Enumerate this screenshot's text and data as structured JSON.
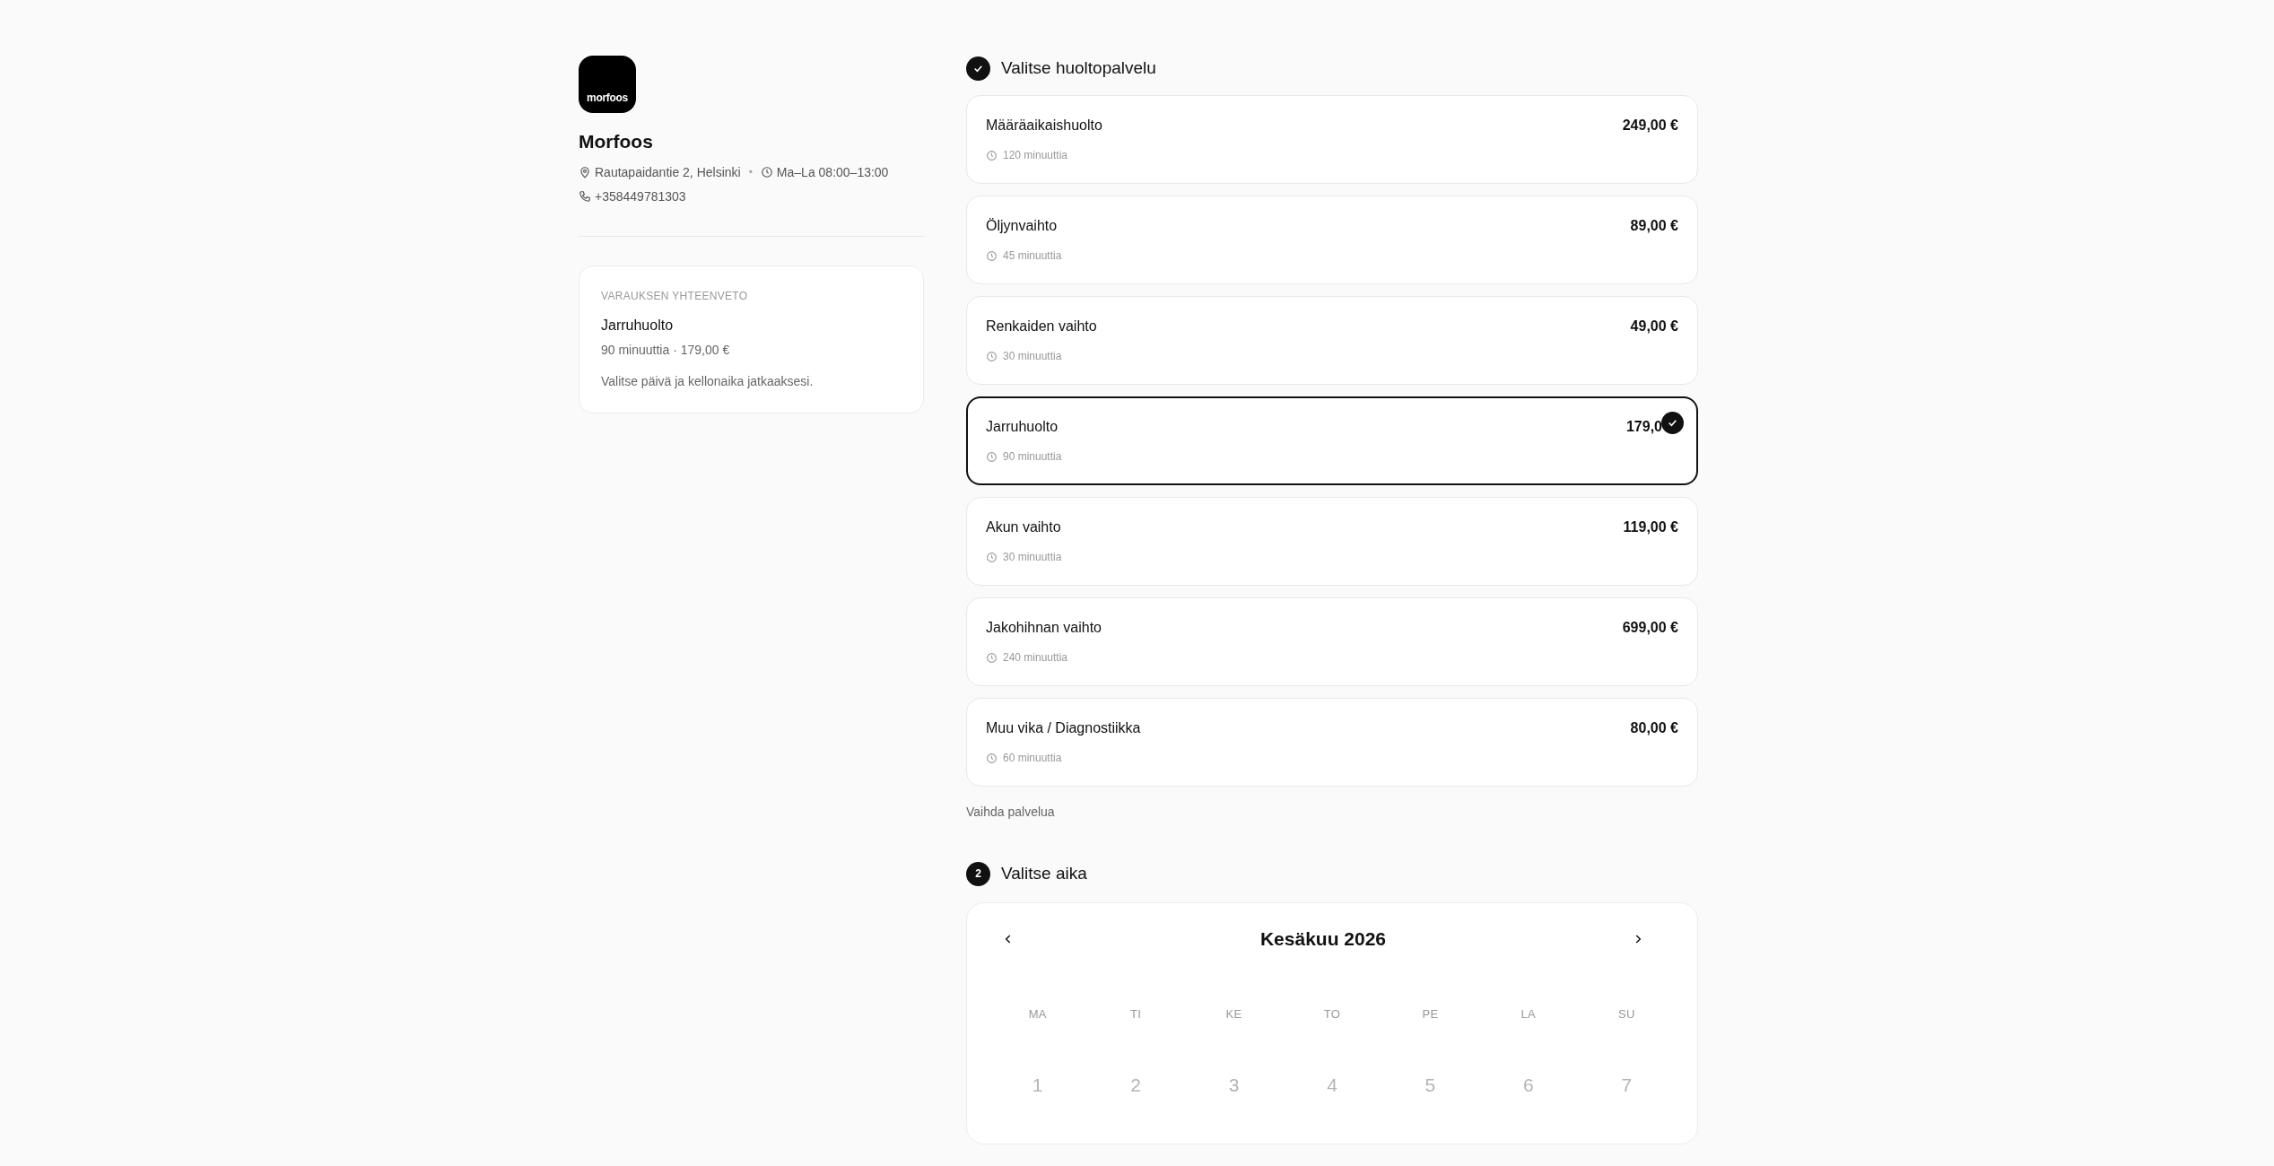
{
  "business": {
    "logo_text": "morfoos",
    "name": "Morfoos",
    "address": "Rautapaidantie 2, Helsinki",
    "separator": "•",
    "hours": "Ma–La 08:00–13:00",
    "phone": "+358449781303"
  },
  "summary": {
    "heading": "VARAUKSEN YHTEENVETO",
    "service": "Jarruhuolto",
    "details": "90 minuuttia · 179,00 €",
    "hint": "Valitse päivä ja kellonaika jatkaaksesi."
  },
  "steps": [
    {
      "kind": "done",
      "title": "Valitse huoltopalvelu"
    },
    {
      "kind": "number",
      "badge": "2",
      "title": "Valitse aika"
    }
  ],
  "services": [
    {
      "name": "Määräaikaishuolto",
      "price": "249,00 €",
      "duration": "120 minuuttia",
      "selected": false
    },
    {
      "name": "Öljynvaihto",
      "price": "89,00 €",
      "duration": "45 minuuttia",
      "selected": false
    },
    {
      "name": "Renkaiden vaihto",
      "price": "49,00 €",
      "duration": "30 minuuttia",
      "selected": false
    },
    {
      "name": "Jarruhuolto",
      "price": "179,0",
      "duration": "90 minuuttia",
      "selected": true
    },
    {
      "name": "Akun vaihto",
      "price": "119,00 €",
      "duration": "30 minuuttia",
      "selected": false
    },
    {
      "name": "Jakohihnan vaihto",
      "price": "699,00 €",
      "duration": "240 minuuttia",
      "selected": false
    },
    {
      "name": "Muu vika / Diagnostiikka",
      "price": "80,00 €",
      "duration": "60 minuuttia",
      "selected": false
    }
  ],
  "change_link": "Vaihda palvelua",
  "calendar": {
    "month": "Kesäkuu 2026",
    "weekdays": [
      "MA",
      "TI",
      "KE",
      "TO",
      "PE",
      "LA",
      "SU"
    ],
    "days": [
      {
        "label": "1",
        "disabled": true
      },
      {
        "label": "2",
        "disabled": true
      },
      {
        "label": "3",
        "disabled": true
      },
      {
        "label": "4",
        "disabled": true
      },
      {
        "label": "5",
        "disabled": true
      },
      {
        "label": "6",
        "disabled": true
      },
      {
        "label": "7",
        "disabled": true
      }
    ]
  }
}
